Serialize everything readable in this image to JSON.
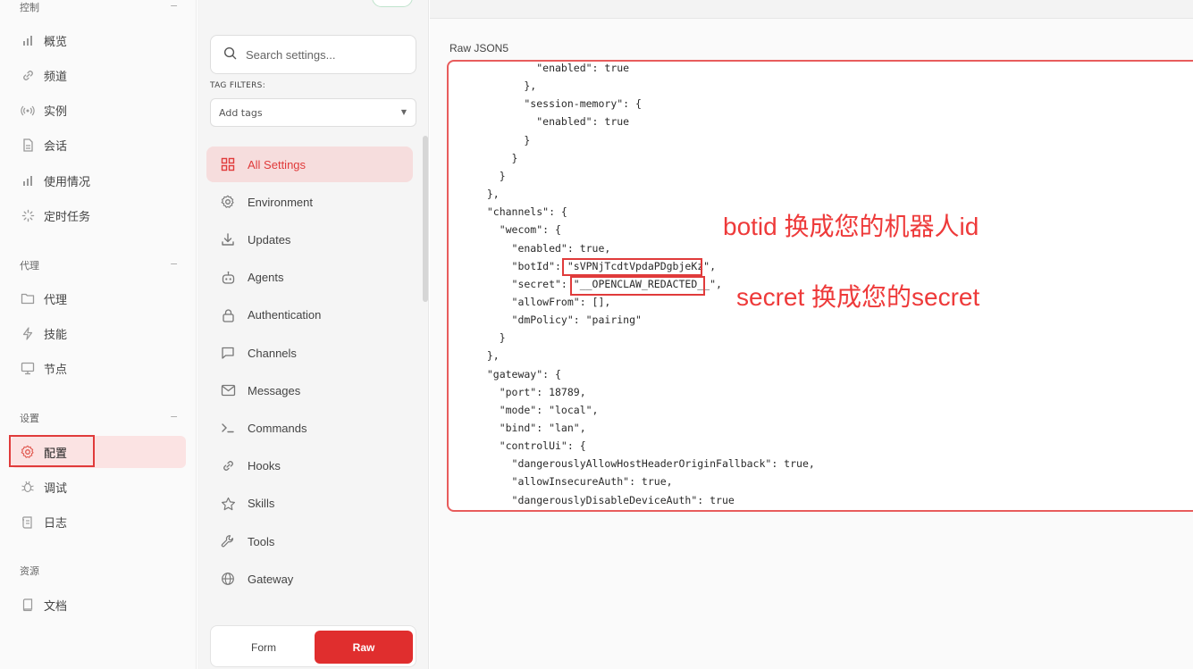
{
  "nav": {
    "groups": [
      {
        "label": "控制",
        "items": [
          {
            "label": "概览",
            "icon": "bar-chart-icon"
          },
          {
            "label": "频道",
            "icon": "link-icon"
          },
          {
            "label": "实例",
            "icon": "broadcast-icon"
          },
          {
            "label": "会话",
            "icon": "document-icon"
          },
          {
            "label": "使用情况",
            "icon": "bar-chart-icon"
          },
          {
            "label": "定时任务",
            "icon": "loader-icon"
          }
        ]
      },
      {
        "label": "代理",
        "items": [
          {
            "label": "代理",
            "icon": "folder-icon"
          },
          {
            "label": "技能",
            "icon": "lightning-icon"
          },
          {
            "label": "节点",
            "icon": "monitor-icon"
          }
        ]
      },
      {
        "label": "设置",
        "items": [
          {
            "label": "配置",
            "icon": "gear-icon",
            "active": true
          },
          {
            "label": "调试",
            "icon": "bug-icon"
          },
          {
            "label": "日志",
            "icon": "scroll-icon"
          }
        ]
      },
      {
        "label": "资源",
        "items": [
          {
            "label": "文档",
            "icon": "book-icon"
          }
        ]
      }
    ]
  },
  "settings": {
    "search_placeholder": "Search settings...",
    "tag_filters_label": "TAG FILTERS:",
    "tag_placeholder": "Add tags",
    "sections": [
      {
        "label": "All Settings",
        "icon": "grid-icon",
        "active": true
      },
      {
        "label": "Environment",
        "icon": "gear-icon"
      },
      {
        "label": "Updates",
        "icon": "download-icon"
      },
      {
        "label": "Agents",
        "icon": "robot-icon"
      },
      {
        "label": "Authentication",
        "icon": "lock-icon"
      },
      {
        "label": "Channels",
        "icon": "chat-icon"
      },
      {
        "label": "Messages",
        "icon": "mail-icon"
      },
      {
        "label": "Commands",
        "icon": "terminal-icon"
      },
      {
        "label": "Hooks",
        "icon": "link-icon"
      },
      {
        "label": "Skills",
        "icon": "star-icon"
      },
      {
        "label": "Tools",
        "icon": "wrench-icon"
      },
      {
        "label": "Gateway",
        "icon": "globe-icon"
      }
    ],
    "mode": {
      "form_label": "Form",
      "raw_label": "Raw",
      "active": "Raw"
    }
  },
  "editor": {
    "label": "Raw JSON5",
    "lines": [
      "          \"enabled\": true",
      "        },",
      "        \"session-memory\": {",
      "          \"enabled\": true",
      "        }",
      "      }",
      "    }",
      "  },",
      "  \"channels\": {",
      "    \"wecom\": {",
      "      \"enabled\": true,",
      "      \"botId\": \"sVPNjTcdtVpdaPDgbjeKz\",",
      "      \"secret\": \"__OPENCLAW_REDACTED__\",",
      "      \"allowFrom\": [],",
      "      \"dmPolicy\": \"pairing\"",
      "    }",
      "  },",
      "  \"gateway\": {",
      "    \"port\": 18789,",
      "    \"mode\": \"local\",",
      "    \"bind\": \"lan\",",
      "    \"controlUi\": {",
      "      \"dangerouslyAllowHostHeaderOriginFallback\": true,",
      "      \"allowInsecureAuth\": true,",
      "      \"dangerouslyDisableDeviceAuth\": true"
    ]
  },
  "annotations": {
    "botid_note": "botid 换成您的机器人id",
    "secret_note": "secret 换成您的secret"
  },
  "colors": {
    "accent": "#e02e2e",
    "annotation": "#ee3a3a",
    "active_bg": "#fbe3e3"
  }
}
